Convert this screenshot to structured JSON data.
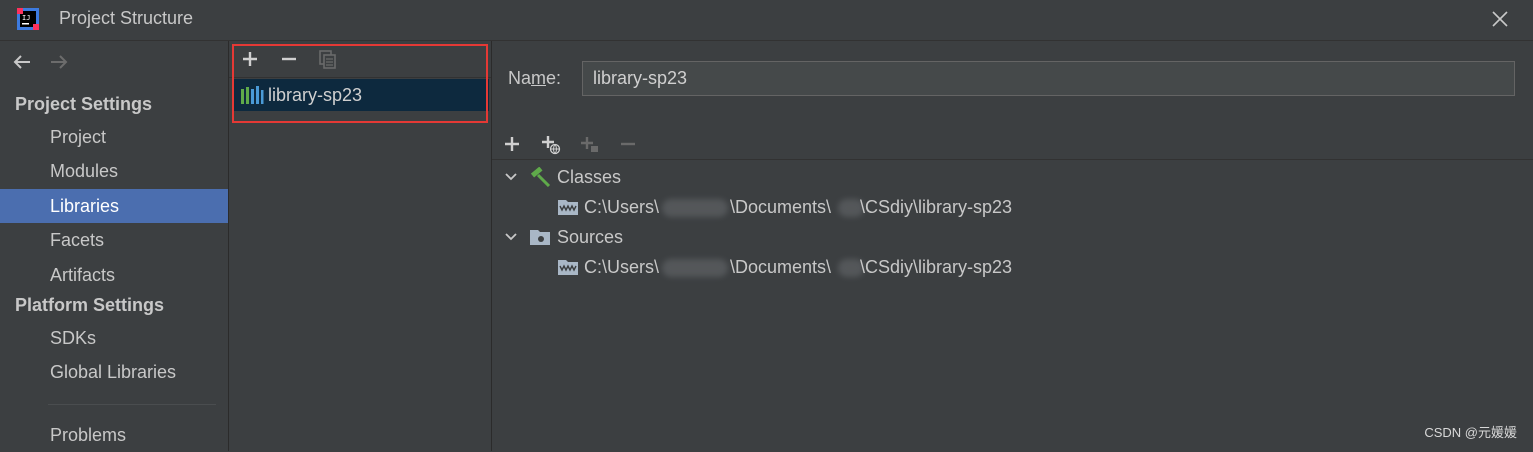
{
  "window": {
    "title": "Project Structure"
  },
  "nav": {
    "project_settings": "Project Settings",
    "items_project": [
      "Project",
      "Modules",
      "Libraries",
      "Facets",
      "Artifacts"
    ],
    "platform_settings": "Platform Settings",
    "items_platform": [
      "SDKs",
      "Global Libraries"
    ],
    "problems": "Problems",
    "selected": "Libraries"
  },
  "libraries": {
    "items": [
      "library-sp23"
    ]
  },
  "detail": {
    "name_label_pre": "Na",
    "name_label_u": "m",
    "name_label_post": "e:",
    "name_value": "library-sp23",
    "tree": [
      {
        "label": "Classes",
        "path_a": "C:\\Users\\",
        "path_b": "\\Documents\\",
        "path_c": "\\CSdiy\\library-sp23"
      },
      {
        "label": "Sources",
        "path_a": "C:\\Users\\",
        "path_b": "\\Documents\\",
        "path_c": "\\CSdiy\\library-sp23"
      }
    ]
  },
  "watermark": "CSDN @元媛媛",
  "icons": [
    "intellij-logo",
    "close-icon",
    "back-arrow-icon",
    "forward-arrow-icon",
    "add-icon",
    "remove-icon",
    "copy-icon",
    "library-icon",
    "add-with-url-icon",
    "add-jar-icon",
    "chevron-down-icon",
    "hammer-icon",
    "folder-icon",
    "jar-folder-icon"
  ],
  "colors": {
    "accent_selected": "#4b6eaf",
    "selection_dark": "#0d293e",
    "highlight_red": "#e53935",
    "hammer_green": "#5faa4a"
  }
}
